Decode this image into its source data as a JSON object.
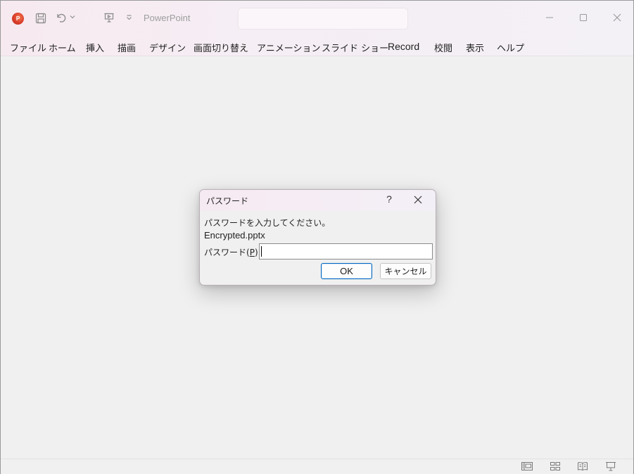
{
  "app": {
    "name": "PowerPoint",
    "logo_letter": "P",
    "search_placeholder": ""
  },
  "quick_access": {
    "icons": [
      "save-icon",
      "undo-icon",
      "undo-dropdown-icon",
      "present-icon",
      "customize-dropdown-icon"
    ]
  },
  "window_controls": [
    "minimize-icon",
    "maximize-icon",
    "close-icon"
  ],
  "menu": {
    "items": [
      {
        "label": "ファイル"
      },
      {
        "label": "ホーム"
      },
      {
        "label": "挿入"
      },
      {
        "label": "描画"
      },
      {
        "label": "デザイン"
      },
      {
        "label": "画面切り替え"
      },
      {
        "label": "アニメーション"
      },
      {
        "label": "スライド ショー"
      },
      {
        "label": "Record"
      },
      {
        "label": "校閲"
      },
      {
        "label": "表示"
      },
      {
        "label": "ヘルプ"
      }
    ]
  },
  "dialog": {
    "title": "パスワード",
    "help": "?",
    "message": "パスワードを入力してください。",
    "filename": "Encrypted.pptx",
    "password_label_prefix": "パスワード(",
    "password_label_key": "P",
    "password_label_suffix": "):",
    "password_value": "",
    "ok_label": "OK",
    "cancel_label": "キャンセル"
  },
  "statusbar": {
    "view_icons": [
      "normal-view-icon",
      "slide-sorter-icon",
      "reading-view-icon",
      "slideshow-icon"
    ]
  },
  "colors": {
    "accent": "#0067c0",
    "title_gradient_start": "#f6eaf0",
    "background": "#f0f0f0"
  }
}
